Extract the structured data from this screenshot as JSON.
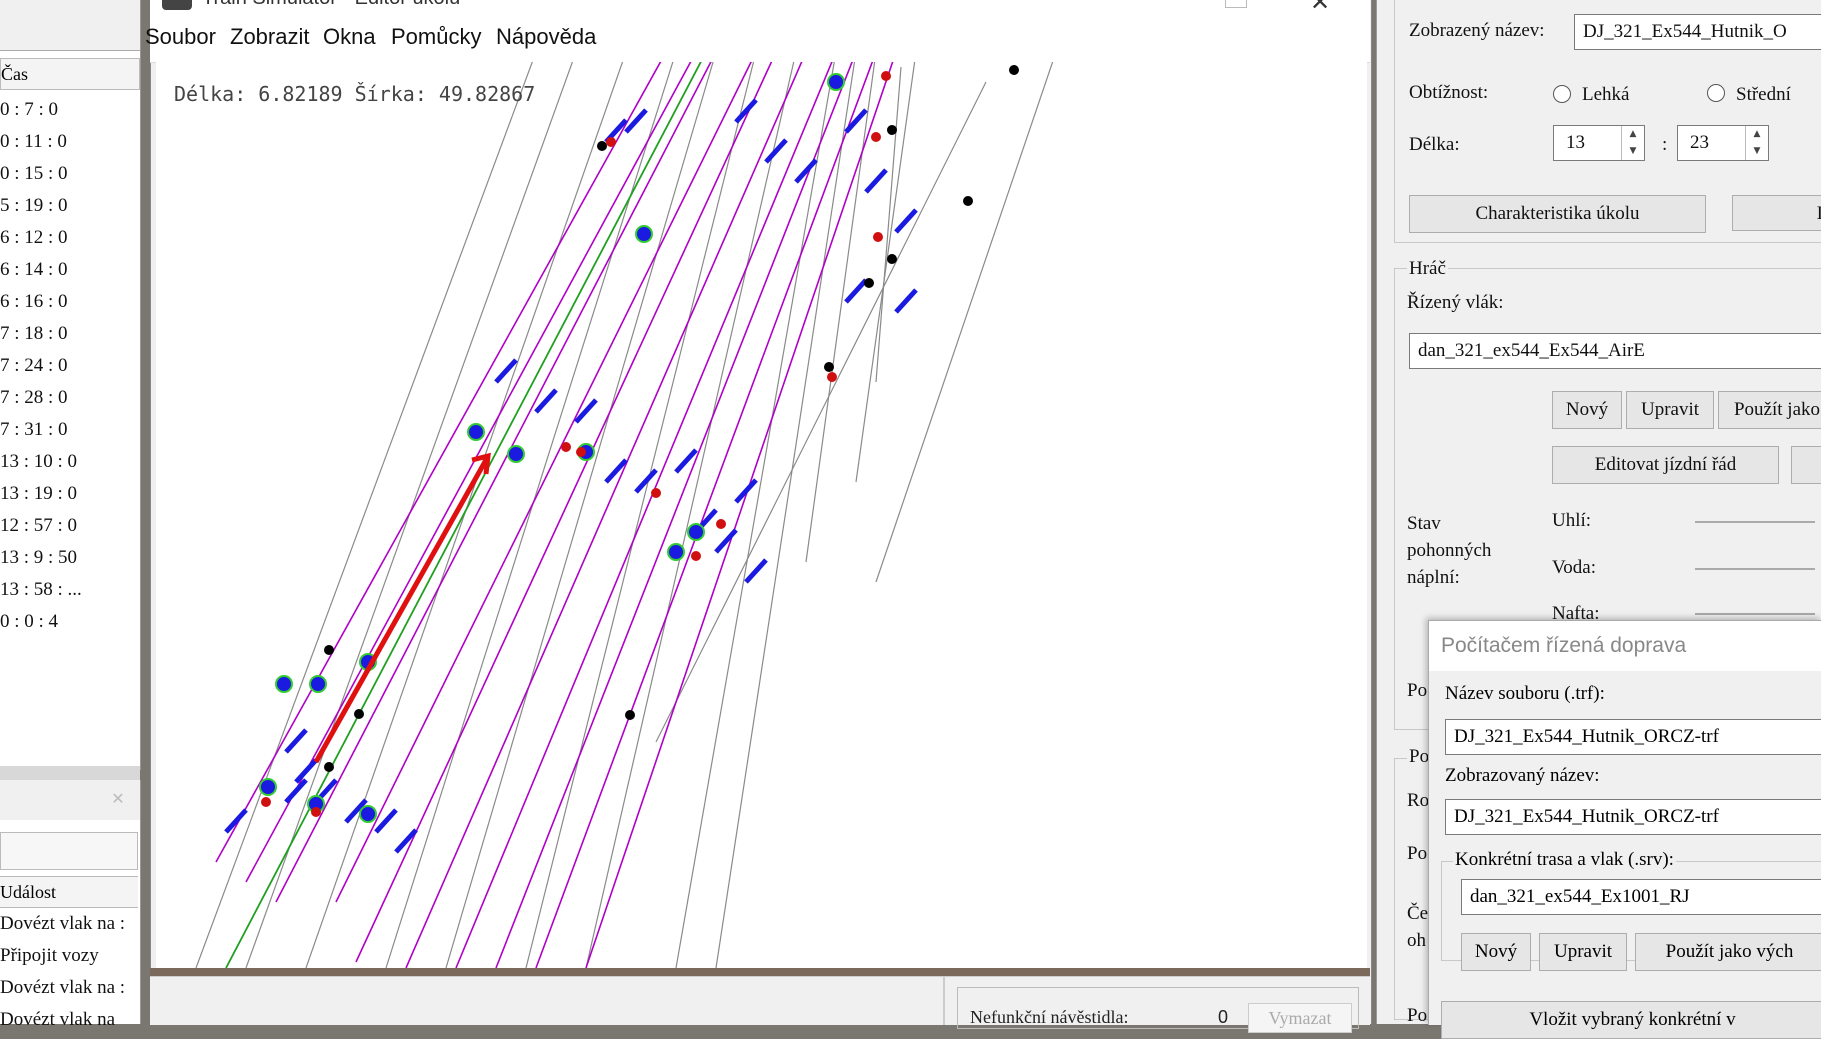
{
  "window": {
    "title": "Train Simulator - Editor úkolů",
    "close_glyph": "✕"
  },
  "menu": [
    "Soubor",
    "Zobrazit",
    "Okna",
    "Pomůcky",
    "Nápověda"
  ],
  "map": {
    "coords": "Délka: 6.82189 Šírka: 49.82867"
  },
  "left_panel": {
    "time_header": "Čas",
    "times": [
      "0 : 7 : 0",
      "0 : 11 : 0",
      "0 : 15 : 0",
      "5 : 19 : 0",
      "6 : 12 : 0",
      "6 : 14 : 0",
      "6 : 16 : 0",
      "7 : 18 : 0",
      "7 : 24 : 0",
      "7 : 28 : 0",
      "7 : 31 : 0",
      "13 : 10 : 0",
      "13 : 19 : 0",
      "12 : 57 : 0",
      "13 : 9 : 50",
      "13 : 58 : ...",
      "0 : 0 : 4"
    ],
    "events_close": "✕",
    "events_header": "Událost",
    "events": [
      "Dovézt vlak na :",
      "Připojit vozy",
      "Dovézt vlak na :",
      "Dovézt vlak na"
    ]
  },
  "bottom_bar": {
    "signals_label": "Nefunkční návěstidla:",
    "signals_count": "0",
    "clear_button": "Vymazat"
  },
  "right_panel": {
    "display_name_label": "Zobrazený název:",
    "display_name_value": "DJ_321_Ex544_Hutnik_O",
    "difficulty_label": "Obtížnost:",
    "difficulty_options": [
      "Lehká",
      "Střední"
    ],
    "length_label": "Délka:",
    "length_hours": "13",
    "length_sep": ":",
    "length_minutes": "23",
    "characteristics_button": "Charakteristika úkolu",
    "characteristics_button_2": "I",
    "player_group": "Hráč",
    "controlled_train_label": "Řízený vlák:",
    "controlled_train_value": "dan_321_ex544_Ex544_AirE",
    "new_button": "Nový",
    "edit_button": "Upravit",
    "use_as_button": "Použít jako",
    "edit_timetable_button": "Editovat jízdní řád",
    "fuel_state_label": "Stav pohonných náplní:",
    "fuel_coal": "Uhlí:",
    "fuel_water": "Voda:",
    "fuel_diesel": "Nafta:",
    "po_label": "Po",
    "po_label_2": "Po",
    "ro_label": "Ro",
    "po_label_3": "Po",
    "ce_label": "Če",
    "oh_label": "oh",
    "po_label_4": "Po"
  },
  "popup": {
    "title": "Počítačem řízená doprava",
    "file_label": "Název souboru (.trf):",
    "file_value": "DJ_321_Ex544_Hutnik_ORCZ-trf",
    "display_label": "Zobrazovaný název:",
    "display_value": "DJ_321_Ex544_Hutnik_ORCZ-trf",
    "route_group": "Konkrétní trasa a vlak (.srv):",
    "route_value": "dan_321_ex544_Ex1001_RJ",
    "new_button": "Nový",
    "edit_button": "Upravit",
    "use_as_button": "Použít jako vých",
    "insert_button": "Vložit vybraný konkrétní v"
  },
  "colors": {
    "track_gray": "#8a8a8a",
    "route_magenta": "#b000c8",
    "route_green": "#20a020",
    "signal_blue": "#1a1ae0",
    "marker_red": "#d01010",
    "arrow_red": "#e01010"
  }
}
